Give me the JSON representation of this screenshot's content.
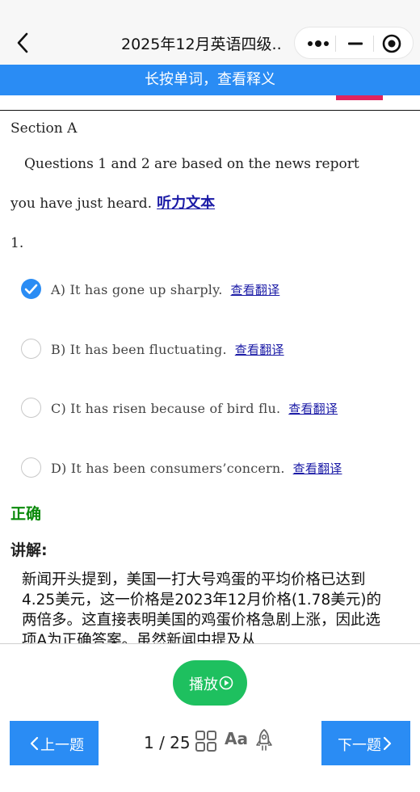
{
  "nav": {
    "title": "2025年12月英语四级...",
    "back_icon": "back-chevron-icon",
    "capsule_icons": [
      "more-dots-icon",
      "minimize-icon",
      "target-icon"
    ]
  },
  "hint_bar": {
    "text": "长按单词，查看释义",
    "color": "#2a8cf4"
  },
  "section": {
    "title": "Section A",
    "intro_line1": "Questions 1 and 2 are based on the news report",
    "intro_line2": "you have just heard.",
    "listen_link": "听力文本"
  },
  "question": {
    "number": "1.",
    "options": [
      {
        "text": "A) It has gone up sharply.",
        "link": "查看翻译",
        "selected": true
      },
      {
        "text": "B) It has been fluctuating.",
        "link": "查看翻译",
        "selected": false
      },
      {
        "text": "C) It has risen because of bird flu.",
        "link": "查看翻译",
        "selected": false
      },
      {
        "text": "D) It has been consumers’concern.",
        "link": "查看翻译",
        "selected": false
      }
    ]
  },
  "result": {
    "text": "正确",
    "color": "#0b8a0b"
  },
  "explanation": {
    "label": "讲解:",
    "text": "新闻开头提到，美国一打大号鸡蛋的平均价格已达到4.25美元，这一价格是2023年12月价格(1.78美元)的两倍多。这直接表明美国的鸡蛋价格急剧上涨，因此选项A为正确答案。虽然新闻中提及从"
  },
  "footer": {
    "play_label": "播放",
    "prev_label": "上一题",
    "next_label": "下一题",
    "page_counter": "1 / 25",
    "font_label": "Aa",
    "icons": [
      "grid-icon",
      "font-size-icon",
      "rocket-icon",
      "play-circle-icon"
    ],
    "play_color": "#1ec05f",
    "button_color": "#2a8cf4"
  }
}
